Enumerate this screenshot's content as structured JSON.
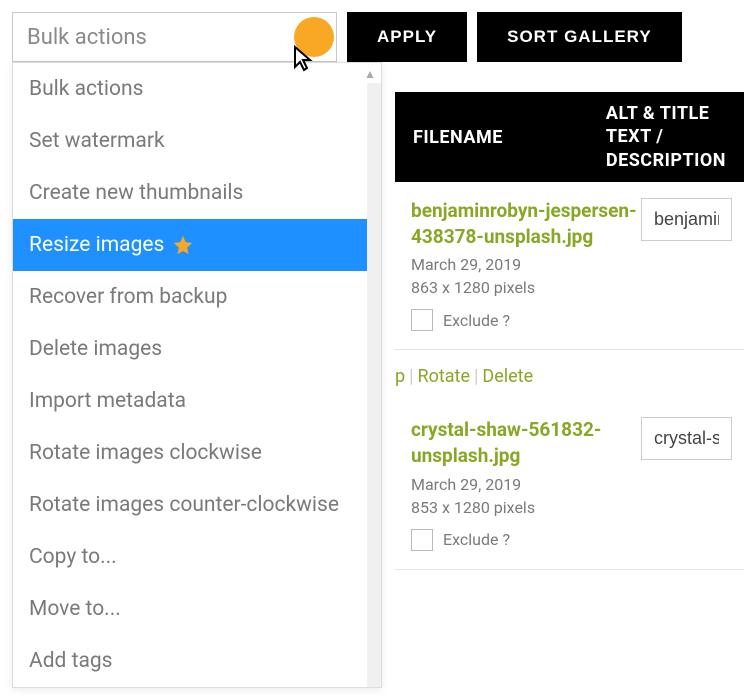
{
  "toolbar": {
    "select_label": "Bulk actions",
    "apply_label": "APPLY",
    "sort_label": "SORT GALLERY"
  },
  "dropdown": {
    "items": [
      {
        "label": "Bulk actions",
        "starred": false,
        "selected": false
      },
      {
        "label": "Set watermark",
        "starred": false,
        "selected": false
      },
      {
        "label": "Create new thumbnails",
        "starred": false,
        "selected": false
      },
      {
        "label": "Resize images",
        "starred": true,
        "selected": true
      },
      {
        "label": "Recover from backup",
        "starred": false,
        "selected": false
      },
      {
        "label": "Delete images",
        "starred": false,
        "selected": false
      },
      {
        "label": "Import metadata",
        "starred": false,
        "selected": false
      },
      {
        "label": "Rotate images clockwise",
        "starred": false,
        "selected": false
      },
      {
        "label": "Rotate images counter-clockwise",
        "starred": false,
        "selected": false
      },
      {
        "label": "Copy to...",
        "starred": false,
        "selected": false
      },
      {
        "label": "Move to...",
        "starred": false,
        "selected": false
      },
      {
        "label": "Add tags",
        "starred": false,
        "selected": false
      }
    ]
  },
  "table": {
    "header_filename": "FILENAME",
    "header_alt": "ALT & TITLE TEXT / DESCRIPTION"
  },
  "rows": [
    {
      "filename": "benjaminrobyn-jespersen-438378-unsplash.jpg",
      "date": "March 29, 2019",
      "dims": "863 x 1280 pixels",
      "exclude_label": "Exclude ?",
      "alt_value": "benjaminrobyn"
    },
    {
      "filename": "crystal-shaw-561832-unsplash.jpg",
      "date": "March 29, 2019",
      "dims": "853 x 1280 pixels",
      "exclude_label": "Exclude ?",
      "alt_value": "crystal-shaw"
    }
  ],
  "actions": {
    "partial": "p",
    "rotate": "Rotate",
    "delete": "Delete"
  }
}
